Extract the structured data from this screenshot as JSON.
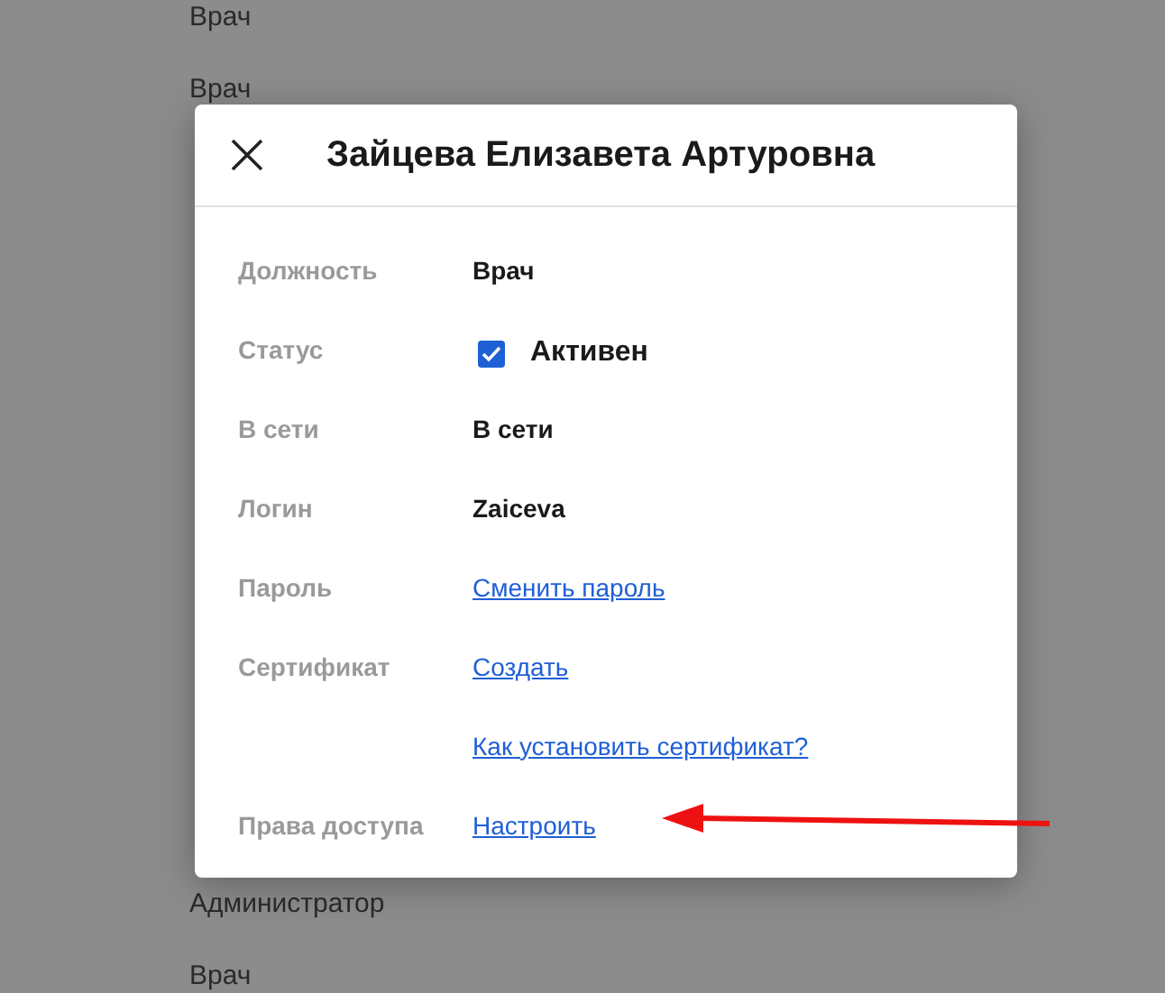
{
  "background_list_top": [
    "Врач",
    "Врач"
  ],
  "background_list_bottom": [
    "Администратор",
    "Врач"
  ],
  "dialog": {
    "title": "Зайцева Елизавета Артуровна",
    "rows": [
      {
        "kind": "text",
        "label": "Должность",
        "value": "Врач"
      },
      {
        "kind": "checkbox",
        "label": "Статус",
        "value": "Активен",
        "checked": true
      },
      {
        "kind": "text",
        "label": "В сети",
        "value": "В сети"
      },
      {
        "kind": "text",
        "label": "Логин",
        "value": "Zaiceva"
      },
      {
        "kind": "link",
        "label": "Пароль",
        "value": "Сменить пароль"
      },
      {
        "kind": "link",
        "label": "Сертификат",
        "value": "Создать"
      },
      {
        "kind": "link",
        "value": "Как установить сертификат?"
      },
      {
        "kind": "link",
        "label": "Права доступа",
        "value": "Настроить"
      }
    ]
  }
}
